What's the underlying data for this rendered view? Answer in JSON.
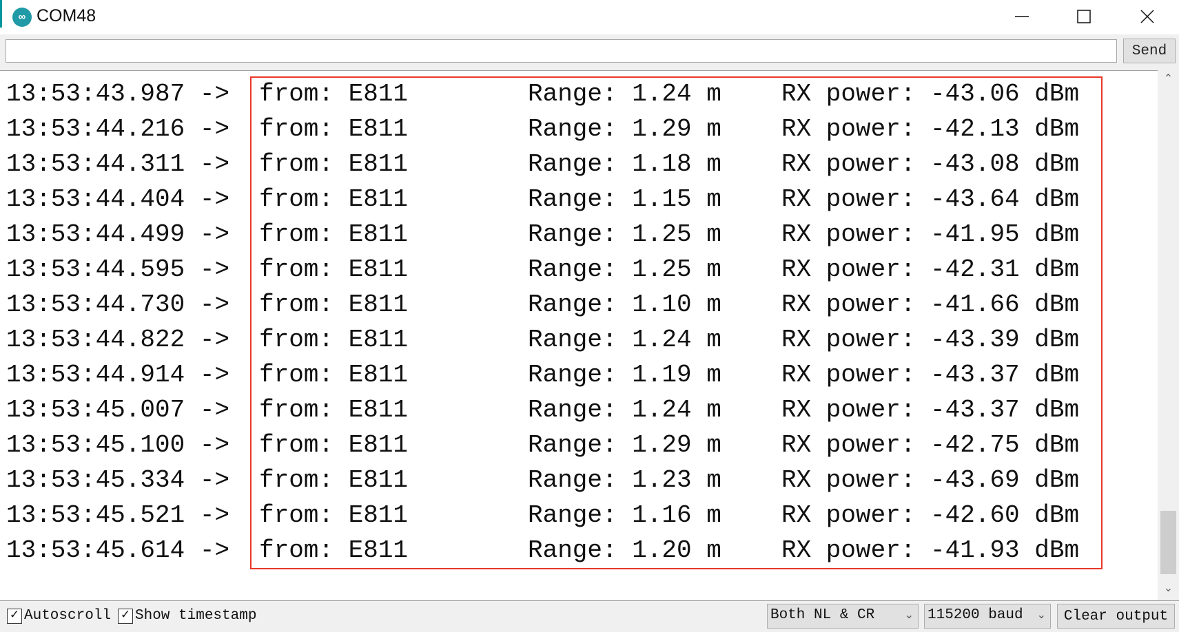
{
  "window": {
    "title": "COM48",
    "logo_icon": "arduino-infinity-icon",
    "accent_color": "#00979c"
  },
  "input": {
    "value": "",
    "send_label": "Send"
  },
  "output": {
    "highlight_color": "#e8372a",
    "rows": [
      {
        "time": "13:53:43.987 ->",
        "from": "from: E811",
        "range": "Range: 1.24 m",
        "rx": "RX power: -43.06 dBm"
      },
      {
        "time": "13:53:44.216 ->",
        "from": "from: E811",
        "range": "Range: 1.29 m",
        "rx": "RX power: -42.13 dBm"
      },
      {
        "time": "13:53:44.311 ->",
        "from": "from: E811",
        "range": "Range: 1.18 m",
        "rx": "RX power: -43.08 dBm"
      },
      {
        "time": "13:53:44.404 ->",
        "from": "from: E811",
        "range": "Range: 1.15 m",
        "rx": "RX power: -43.64 dBm"
      },
      {
        "time": "13:53:44.499 ->",
        "from": "from: E811",
        "range": "Range: 1.25 m",
        "rx": "RX power: -41.95 dBm"
      },
      {
        "time": "13:53:44.595 ->",
        "from": "from: E811",
        "range": "Range: 1.25 m",
        "rx": "RX power: -42.31 dBm"
      },
      {
        "time": "13:53:44.730 ->",
        "from": "from: E811",
        "range": "Range: 1.10 m",
        "rx": "RX power: -41.66 dBm"
      },
      {
        "time": "13:53:44.822 ->",
        "from": "from: E811",
        "range": "Range: 1.24 m",
        "rx": "RX power: -43.39 dBm"
      },
      {
        "time": "13:53:44.914 ->",
        "from": "from: E811",
        "range": "Range: 1.19 m",
        "rx": "RX power: -43.37 dBm"
      },
      {
        "time": "13:53:45.007 ->",
        "from": "from: E811",
        "range": "Range: 1.24 m",
        "rx": "RX power: -43.37 dBm"
      },
      {
        "time": "13:53:45.100 ->",
        "from": "from: E811",
        "range": "Range: 1.29 m",
        "rx": "RX power: -42.75 dBm"
      },
      {
        "time": "13:53:45.334 ->",
        "from": "from: E811",
        "range": "Range: 1.23 m",
        "rx": "RX power: -43.69 dBm"
      },
      {
        "time": "13:53:45.521 ->",
        "from": "from: E811",
        "range": "Range: 1.16 m",
        "rx": "RX power: -42.60 dBm"
      },
      {
        "time": "13:53:45.614 ->",
        "from": "from: E811",
        "range": "Range: 1.20 m",
        "rx": "RX power: -41.93 dBm"
      }
    ]
  },
  "scrollbar": {
    "position": "bottom"
  },
  "bottom": {
    "autoscroll": {
      "label": "Autoscroll",
      "checked": true
    },
    "timestamp": {
      "label": "Show timestamp",
      "checked": true
    },
    "line_ending": "Both NL & CR",
    "baud": "115200 baud",
    "clear_label": "Clear output"
  }
}
